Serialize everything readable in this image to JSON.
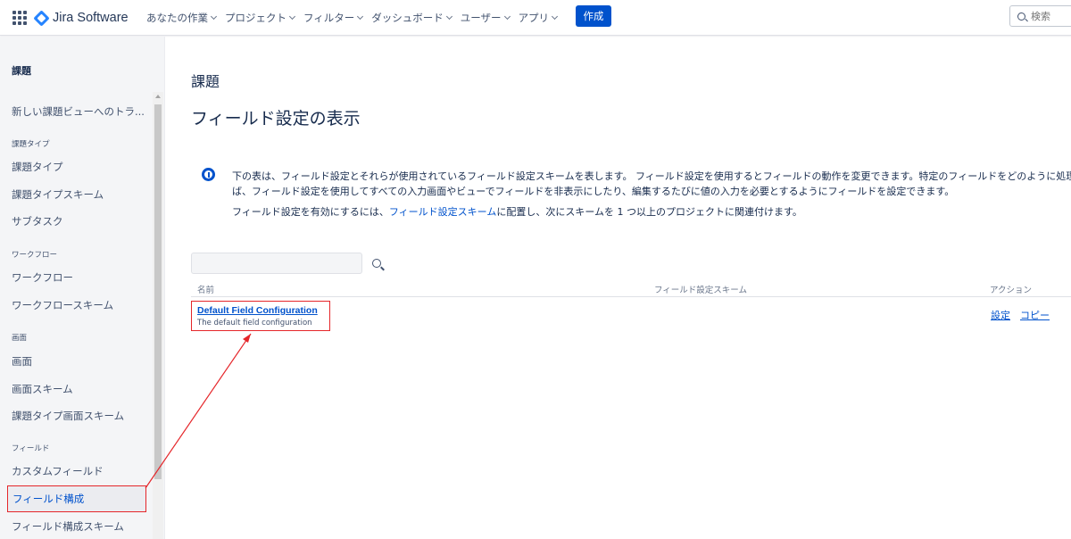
{
  "topnav": {
    "logo_text": "Jira Software",
    "menu": [
      "あなたの作業",
      "プロジェクト",
      "フィルター",
      "ダッシュボード",
      "ユーザー",
      "アプリ"
    ],
    "create_label": "作成",
    "search_placeholder": "検索"
  },
  "sidebar": {
    "title": "課題",
    "top_item": "新しい課題ビューへのトラ...",
    "sections": [
      {
        "label": "課題タイプ",
        "items": [
          "課題タイプ",
          "課題タイプスキーム",
          "サブタスク"
        ]
      },
      {
        "label": "ワークフロー",
        "items": [
          "ワークフロー",
          "ワークフロースキーム"
        ]
      },
      {
        "label": "画面",
        "items": [
          "画面",
          "画面スキーム",
          "課題タイプ画面スキーム"
        ]
      },
      {
        "label": "フィールド",
        "items": [
          "カスタムフィールド",
          "フィールド構成",
          "フィールド構成スキーム"
        ]
      }
    ],
    "active_item": "フィールド構成"
  },
  "main": {
    "heading": "課題",
    "title": "フィールド設定の表示",
    "info_line1": "下の表は、フィールド設定とそれらが使用されているフィールド設定スキームを表します。 フィールド設定を使用するとフィールドの動作を変更できます。特定のフィールドをどのように処理するか",
    "info_line1b": "ば、フィールド設定を使用してすべての入力画面やビューでフィールドを非表示にしたり、編集するたびに値の入力を必要とするようにフィールドを設定できます。",
    "info_line2_prefix": "フィールド設定を有効にするには、",
    "info_line2_link": "フィールド設定スキーム",
    "info_line2_suffix": "に配置し、次にスキームを 1 つ以上のプロジェクトに関連付けます。",
    "table": {
      "headers": [
        "名前",
        "フィールド設定スキーム",
        "アクション"
      ],
      "rows": [
        {
          "name": "Default Field Configuration",
          "description": "The default field configuration",
          "actions": [
            "設定",
            "コピー"
          ]
        }
      ]
    }
  },
  "colors": {
    "accent": "#0052cc",
    "annotation": "#e5262a",
    "sidebar_bg": "#f4f5f7"
  }
}
